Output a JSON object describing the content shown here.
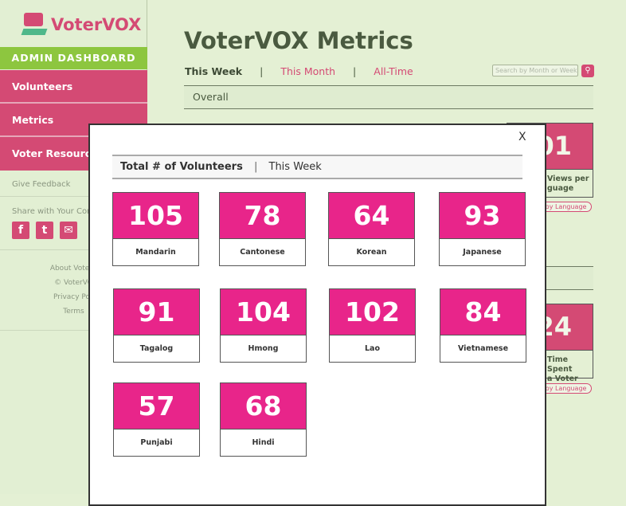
{
  "sidebar": {
    "logo": "VoterVOX",
    "admin": "ADMIN DASHBOARD",
    "nav": [
      {
        "label": "Volunteers"
      },
      {
        "label": "Metrics"
      },
      {
        "label": "Voter Resources"
      }
    ],
    "feedback": "Give Feedback",
    "share": "Share with Your Com",
    "social": [
      {
        "icon": "facebook-icon",
        "glyph": "f"
      },
      {
        "icon": "twitter-icon",
        "glyph": "t"
      },
      {
        "icon": "mail-icon",
        "glyph": "✉"
      }
    ],
    "footer": [
      "About VoterV",
      "© VoterVO",
      "Privacy Poli",
      "Terms"
    ]
  },
  "main": {
    "title": "VoterVOX Metrics",
    "tabs": [
      "This Week",
      "|",
      "This Month",
      "|",
      "All-Time"
    ],
    "search_placeholder": "Search by Month or Week",
    "section1": "Overall",
    "bg_cards": [
      {
        "value": "01",
        "label_line1": "Views per",
        "label_line2": "guage",
        "button": "n by Language"
      },
      {
        "value": "24",
        "label_line1": "Time Spent",
        "label_line2": "a Voter",
        "button": "n by Language"
      }
    ]
  },
  "modal": {
    "close": "X",
    "title": "Total # of Volunteers",
    "sep": "|",
    "period": "This Week",
    "cards": [
      {
        "value": "105",
        "language": "Mandarin"
      },
      {
        "value": "78",
        "language": "Cantonese"
      },
      {
        "value": "64",
        "language": "Korean"
      },
      {
        "value": "93",
        "language": "Japanese"
      },
      {
        "value": "91",
        "language": "Tagalog"
      },
      {
        "value": "104",
        "language": "Hmong"
      },
      {
        "value": "102",
        "language": "Lao"
      },
      {
        "value": "84",
        "language": "Vietnamese"
      },
      {
        "value": "57",
        "language": "Punjabi"
      },
      {
        "value": "68",
        "language": "Hindi"
      }
    ]
  },
  "colors": {
    "accent": "#d44a74",
    "card": "#e8258a",
    "admin": "#8dc63f",
    "background": "#e4f0d4"
  }
}
